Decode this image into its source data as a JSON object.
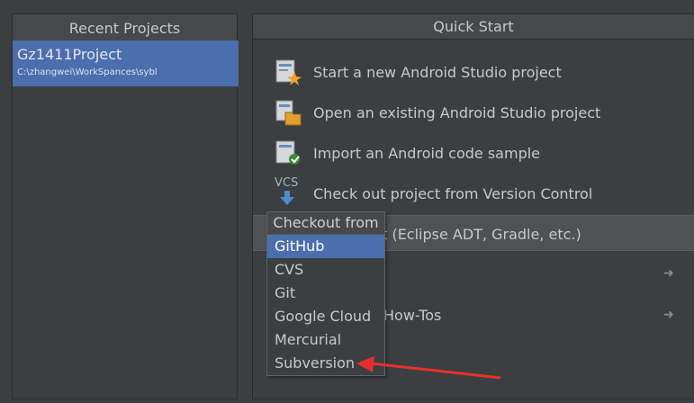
{
  "recent_projects": {
    "title": "Recent Projects",
    "items": [
      {
        "name": "Gz1411Project",
        "path": "C:\\zhangwei\\WorkSpances\\sybl"
      }
    ]
  },
  "quick_start": {
    "title": "Quick Start",
    "actions": [
      {
        "label": "Start a new Android Studio project",
        "icon": "new-project-icon"
      },
      {
        "label": "Open an existing Android Studio project",
        "icon": "open-project-icon"
      },
      {
        "label": "Import an Android code sample",
        "icon": "import-sample-icon"
      },
      {
        "label": "Check out project from Version Control",
        "icon": "vcs-icon"
      },
      {
        "label": "ject (Eclipse ADT, Gradle, etc.)",
        "icon": "import-project-icon"
      },
      {
        "label": "",
        "icon": "arrow-right-icon"
      },
      {
        "label": "How-Tos",
        "icon": "arrow-right-icon"
      }
    ],
    "vcs_icon_text": "VCS"
  },
  "checkout_popup": {
    "title": "Checkout from",
    "items": [
      "GitHub",
      "CVS",
      "Git",
      "Google Cloud",
      "Mercurial",
      "Subversion"
    ],
    "selected": "GitHub"
  },
  "colors": {
    "background": "#3c3f41",
    "selection": "#4b6eaf",
    "annotation_arrow": "#e8302a"
  }
}
